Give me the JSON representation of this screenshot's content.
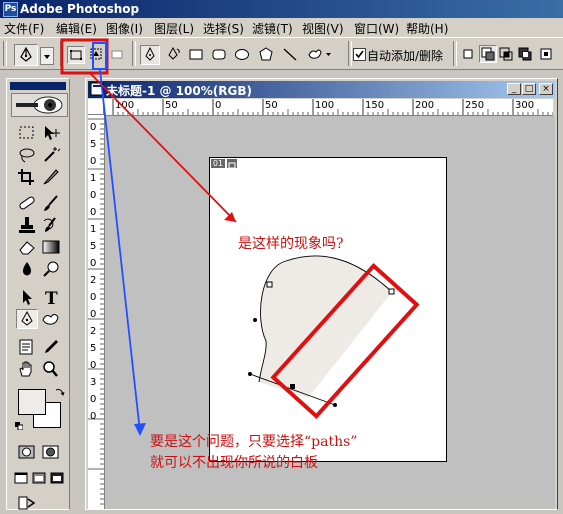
{
  "app": {
    "title": "Adobe Photoshop"
  },
  "menu": [
    "文件(F)",
    "编辑(E)",
    "图像(I)",
    "图层(L)",
    "选择(S)",
    "滤镜(T)",
    "视图(V)",
    "窗口(W)",
    "帮助(H)"
  ],
  "options": {
    "auto_add_delete_label": "自动添加/删除",
    "auto_add_delete_checked": true
  },
  "document": {
    "title": "未标题-1 @ 100%(RGB)",
    "ruler_h": [
      "100",
      "50",
      "0",
      "50",
      "100",
      "150",
      "200",
      "250",
      "300"
    ],
    "ruler_v": [
      "0",
      "5",
      "0",
      "1",
      "0",
      "0",
      "1",
      "5",
      "0",
      "2",
      "0",
      "0",
      "2",
      "5",
      "0",
      "3",
      "0",
      "0"
    ],
    "layer_badge": "01"
  },
  "annotations": {
    "question": "是这样的现象吗?",
    "answer_line1": "要是这个问题，只要选择“paths”",
    "answer_line2": "就可以不出现你所说的白板"
  },
  "colors": {
    "annotation_red": "#e01010",
    "annotation_blue": "#2050ff",
    "title_blue": "#0a246a"
  }
}
